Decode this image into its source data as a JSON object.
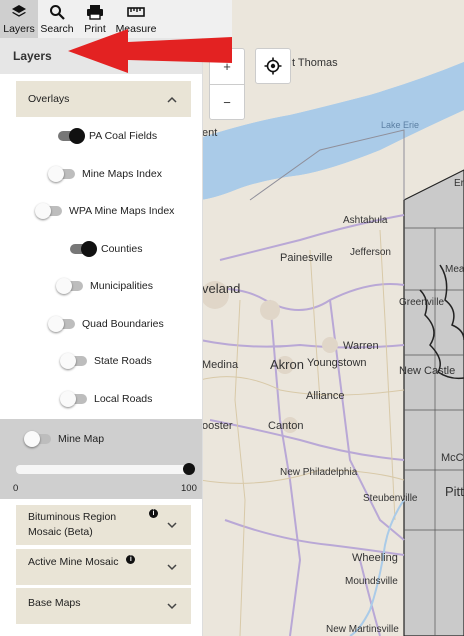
{
  "toolbar": {
    "items": [
      {
        "label": "Layers",
        "icon": "layers-icon",
        "active": true
      },
      {
        "label": "Search",
        "icon": "search-icon"
      },
      {
        "label": "Print",
        "icon": "print-icon"
      },
      {
        "label": "Measure",
        "icon": "ruler-icon"
      }
    ]
  },
  "panel": {
    "title": "Layers",
    "overlays_label": "Overlays",
    "overlays": [
      {
        "label": "PA Coal Fields",
        "on": true
      },
      {
        "label": "Mine Maps Index",
        "on": false
      },
      {
        "label": "WPA Mine Maps Index",
        "on": false
      },
      {
        "label": "Counties",
        "on": true
      },
      {
        "label": "Municipalities",
        "on": false
      },
      {
        "label": "Quad Boundaries",
        "on": false
      },
      {
        "label": "State Roads",
        "on": false
      },
      {
        "label": "Local Roads",
        "on": false
      }
    ],
    "mine_map": {
      "label": "Mine Map",
      "on": false,
      "opacity_min": "0",
      "opacity_max": "100",
      "opacity_value": 100
    },
    "sections": [
      {
        "label": "Bituminous Region Mosaic (Beta)",
        "has_info": true
      },
      {
        "label": "Active Mine Mosaic",
        "has_info": true
      },
      {
        "label": "Base Maps",
        "has_info": false
      }
    ]
  },
  "map": {
    "zoom_in": "+",
    "zoom_out": "−",
    "labels": {
      "st_thomas": "t Thomas",
      "ent": "ent",
      "lake_erie": "Lake Erie",
      "ashtabula": "Ashtabula",
      "jefferson": "Jefferson",
      "painesville": "Painesville",
      "cleveland": "veland",
      "medina": "Medina",
      "akron": "Akron",
      "youngstown": "Youngstown",
      "warren": "Warren",
      "alliance": "Alliance",
      "canton": "Canton",
      "wooster": "ooster",
      "new_philadelphia": "New Philadelphia",
      "steubenville": "Steubenville",
      "wheeling": "Wheeling",
      "moundsville": "Moundsville",
      "new_martinsville": "New Martinsville",
      "greenville": "Greenville",
      "new_castle": "New Castle",
      "meadville": "Mead",
      "erie_part": "Er",
      "mcc": "McC",
      "pit": "Pitt"
    },
    "colors": {
      "water": "#aacbe8",
      "land": "#e8e4dc",
      "highlight": "#c9c9c9",
      "accent_arrow": "#e32222"
    }
  }
}
